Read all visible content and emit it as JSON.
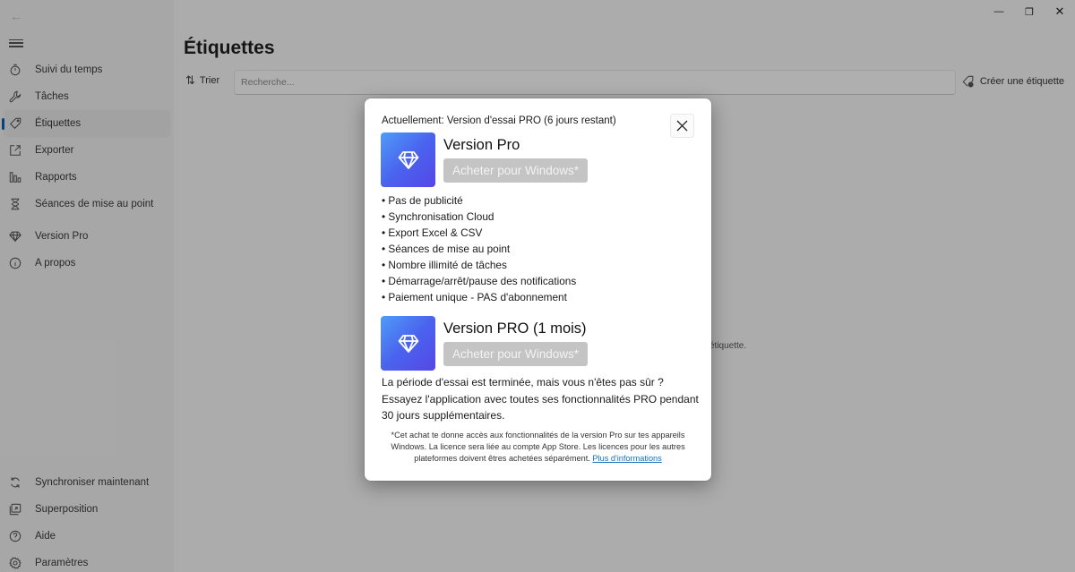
{
  "window": {
    "controls": {
      "minimize": "minimize-icon",
      "restore": "restore-icon",
      "close": "close-icon"
    }
  },
  "sidebar": {
    "back_icon": "arrow-left-icon",
    "menu_icon": "hamburger-icon",
    "top_items": [
      {
        "label": "Suivi du temps",
        "icon": "stopwatch-icon",
        "active": false
      },
      {
        "label": "Tâches",
        "icon": "wrench-icon",
        "active": false
      },
      {
        "label": "Étiquettes",
        "icon": "tag-icon",
        "active": true
      },
      {
        "label": "Exporter",
        "icon": "export-icon",
        "active": false
      },
      {
        "label": "Rapports",
        "icon": "bar-chart-icon",
        "active": false
      },
      {
        "label": "Séances de mise au point",
        "icon": "hourglass-icon",
        "active": false
      }
    ],
    "mid_items": [
      {
        "label": "Version Pro",
        "icon": "diamond-icon"
      },
      {
        "label": "A propos",
        "icon": "info-icon"
      }
    ],
    "bottom_items": [
      {
        "label": "Synchroniser maintenant",
        "icon": "sync-icon"
      },
      {
        "label": "Superposition",
        "icon": "overlay-icon"
      },
      {
        "label": "Aide",
        "icon": "help-icon"
      },
      {
        "label": "Paramètres",
        "icon": "gear-icon"
      }
    ],
    "active_color": "#0a5fb4"
  },
  "main": {
    "title": "Étiquettes",
    "sort_label": "Trier",
    "search": {
      "placeholder": "Recherche...",
      "value": ""
    },
    "create_label": "Créer une étiquette",
    "empty_message_visible": "étiquette."
  },
  "modal": {
    "status": "Actuellement: Version d'essai PRO (6 jours restant)",
    "offers": [
      {
        "title": "Version Pro",
        "button": "Acheter pour Windows*",
        "icon": "diamond-icon"
      },
      {
        "title": "Version PRO (1 mois)",
        "button": "Acheter pour Windows*",
        "icon": "diamond-icon"
      }
    ],
    "features": [
      "Pas de publicité",
      "Synchronisation Cloud",
      "Export Excel & CSV",
      "Séances de mise au point",
      "Nombre illimité de tâches",
      "Démarrage/arrêt/pause des notifications",
      "Paiement unique - PAS d'abonnement"
    ],
    "trial_text": "La période d'essai est terminée, mais vous n'êtes pas sûr ? Essayez l'application avec toutes ses fonctionnalités PRO pendant 30 jours supplémentaires.",
    "disclaimer": "*Cet achat te donne accès aux fonctionnalités de la version Pro sur tes appareils Windows. La licence sera liée au compte App Store. Les licences pour les autres plateformes doivent êtres achetées séparément.",
    "more_info_link": "Plus d'informations",
    "tile_gradient": [
      "#4f9cf9",
      "#4a63ee",
      "#5646e8"
    ],
    "link_color": "#1a6fb8"
  }
}
